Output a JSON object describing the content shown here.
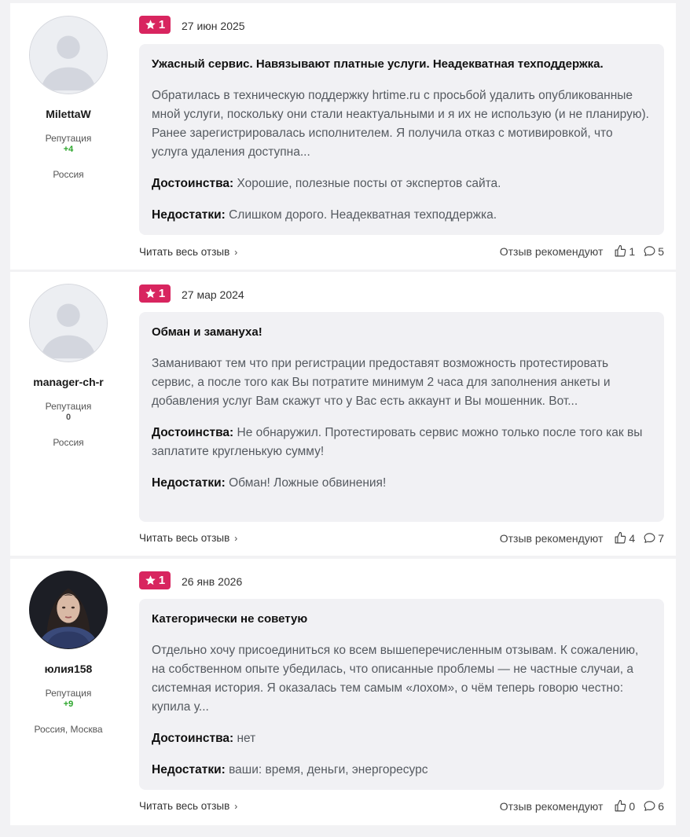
{
  "reviews": [
    {
      "username": "MilettaW",
      "rep_label": "Репутация",
      "rep_value": "+4",
      "rep_color": "#2aa52a",
      "location": "Россия",
      "rating": "1",
      "date": "27 июн 2025",
      "title": "Ужасный сервис. Навязывают платные услуги. Неадекватная техподдержка.",
      "text": "Обратилась в техническую поддержку hrtime.ru с просьбой удалить опубликованные мной услуги, поскольку они стали неактуальными и я их не использую (и не планирую). Ранее зарегистрировалась исполнителем. Я получила отказ с мотивировкой, что услуга удаления доступна...",
      "pros_label": "Достоинства:",
      "pros": "Хорошие, полезные посты от экспертов сайта.",
      "cons_label": "Недостатки:",
      "cons": "Слишком дорого. Неадекватная техподдержка.",
      "read_more": "Читать весь отзыв",
      "recommend_label": "Отзыв рекомендуют",
      "likes": "1",
      "comments": "5"
    },
    {
      "username": "manager-ch-r",
      "rep_label": "Репутация",
      "rep_value": "0",
      "rep_color": "#555555",
      "location": "Россия",
      "rating": "1",
      "date": "27 мар 2024",
      "title": "Обман и замануха!",
      "text": "Заманивают тем что при регистрации предоставят возможность протестировать сервис, а после того как Вы потратите минимум 2 часа для заполнения анкеты и добавления услуг Вам скажут что у Вас есть аккаунт и Вы мошенник. Вот...",
      "pros_label": "Достоинства:",
      "pros": "Не обнаружил. Протестировать сервис можно только после того как вы заплатите кругленькую сумму!",
      "cons_label": "Недостатки:",
      "cons": "Обман! Ложные обвинения!",
      "read_more": "Читать весь отзыв",
      "recommend_label": "Отзыв рекомендуют",
      "likes": "4",
      "comments": "7"
    },
    {
      "username": "юлия158",
      "rep_label": "Репутация",
      "rep_value": "+9",
      "rep_color": "#2aa52a",
      "location": "Россия, Москва",
      "rating": "1",
      "date": "26 янв 2026",
      "title": "Категорически не советую",
      "text": "Отдельно хочу присоединиться ко всем вышеперечисленным отзывам. К сожалению, на собственном опыте убедилась, что описанные проблемы — не частные случаи, а системная история. Я оказалась тем самым «лохом», о чём теперь говорю честно: купила у...",
      "pros_label": "Достоинства:",
      "pros": "нет",
      "cons_label": "Недостатки:",
      "cons": "ваши: время, деньги, энергоресурс",
      "read_more": "Читать весь отзыв",
      "recommend_label": "Отзыв рекомендуют",
      "likes": "0",
      "comments": "6"
    }
  ],
  "colors": {
    "badge": "#d8255f",
    "review_bg": "#f1f1f4",
    "rep_positive": "#2aa52a"
  },
  "icons": {
    "star": "star-icon",
    "thumbs_up": "thumbs-up-icon",
    "comment": "comment-icon",
    "chevron": "chevron-right-icon",
    "avatar_placeholder": "user-placeholder-icon"
  }
}
